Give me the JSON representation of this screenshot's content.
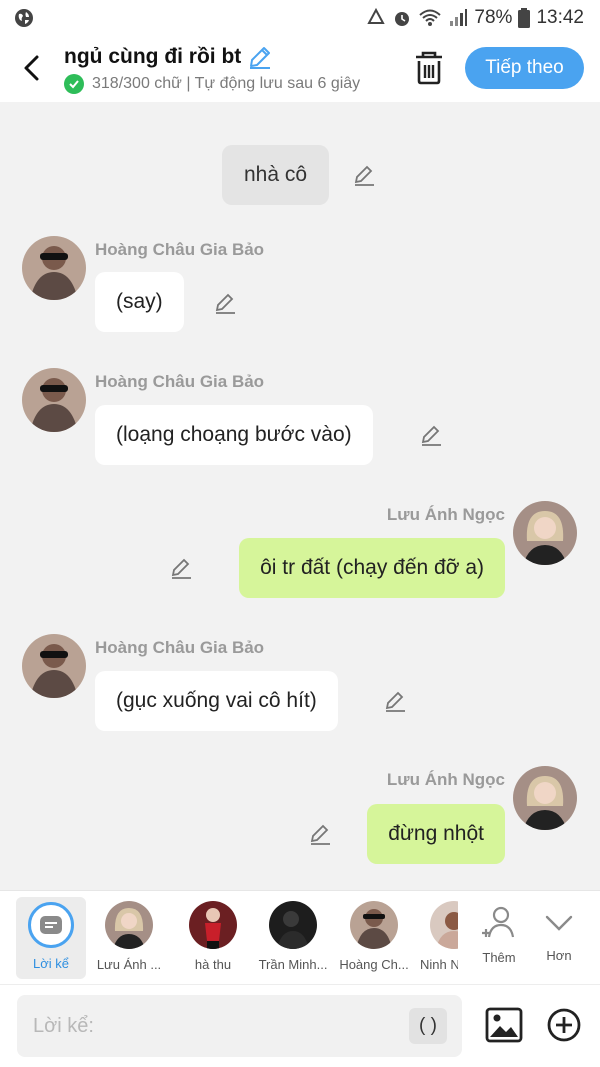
{
  "status_bar": {
    "battery": "78%",
    "time": "13:42"
  },
  "header": {
    "title": "ngủ cùng đi rồi bt",
    "subtitle": "318/300 chữ | Tự động lưu sau 6 giây",
    "next_label": "Tiếp theo"
  },
  "messages": [
    {
      "type": "narration",
      "text": "nhà cô"
    },
    {
      "type": "left",
      "name": "Hoàng Châu Gia Bảo",
      "text": "(say)"
    },
    {
      "type": "left",
      "name": "Hoàng Châu Gia Bảo",
      "text": "(loạng choạng bước vào)"
    },
    {
      "type": "right",
      "name": "Lưu Ánh Ngọc",
      "text": "ôi tr đất (chạy đến đỡ a)"
    },
    {
      "type": "left",
      "name": "Hoàng Châu Gia Bảo",
      "text": "(gục xuống vai cô hít)"
    },
    {
      "type": "right",
      "name": "Lưu Ánh Ngọc",
      "text": "đừng nhột"
    }
  ],
  "characters": [
    {
      "label": "Lời kể",
      "icon": "narrator-icon"
    },
    {
      "label": "Lưu Ánh ..."
    },
    {
      "label": "hà thu"
    },
    {
      "label": "Trần Minh..."
    },
    {
      "label": "Hoàng Ch..."
    },
    {
      "label": "Ninh N"
    }
  ],
  "actions": {
    "add_label": "Thêm",
    "more_label": "Hơn"
  },
  "input": {
    "placeholder": "Lời kể:",
    "paren_label": "( )"
  },
  "colors": {
    "accent": "#4aa3f0",
    "right_bubble": "#d6f59a",
    "left_bubble": "#ffffff",
    "narration_bubble": "#e4e4e4"
  }
}
